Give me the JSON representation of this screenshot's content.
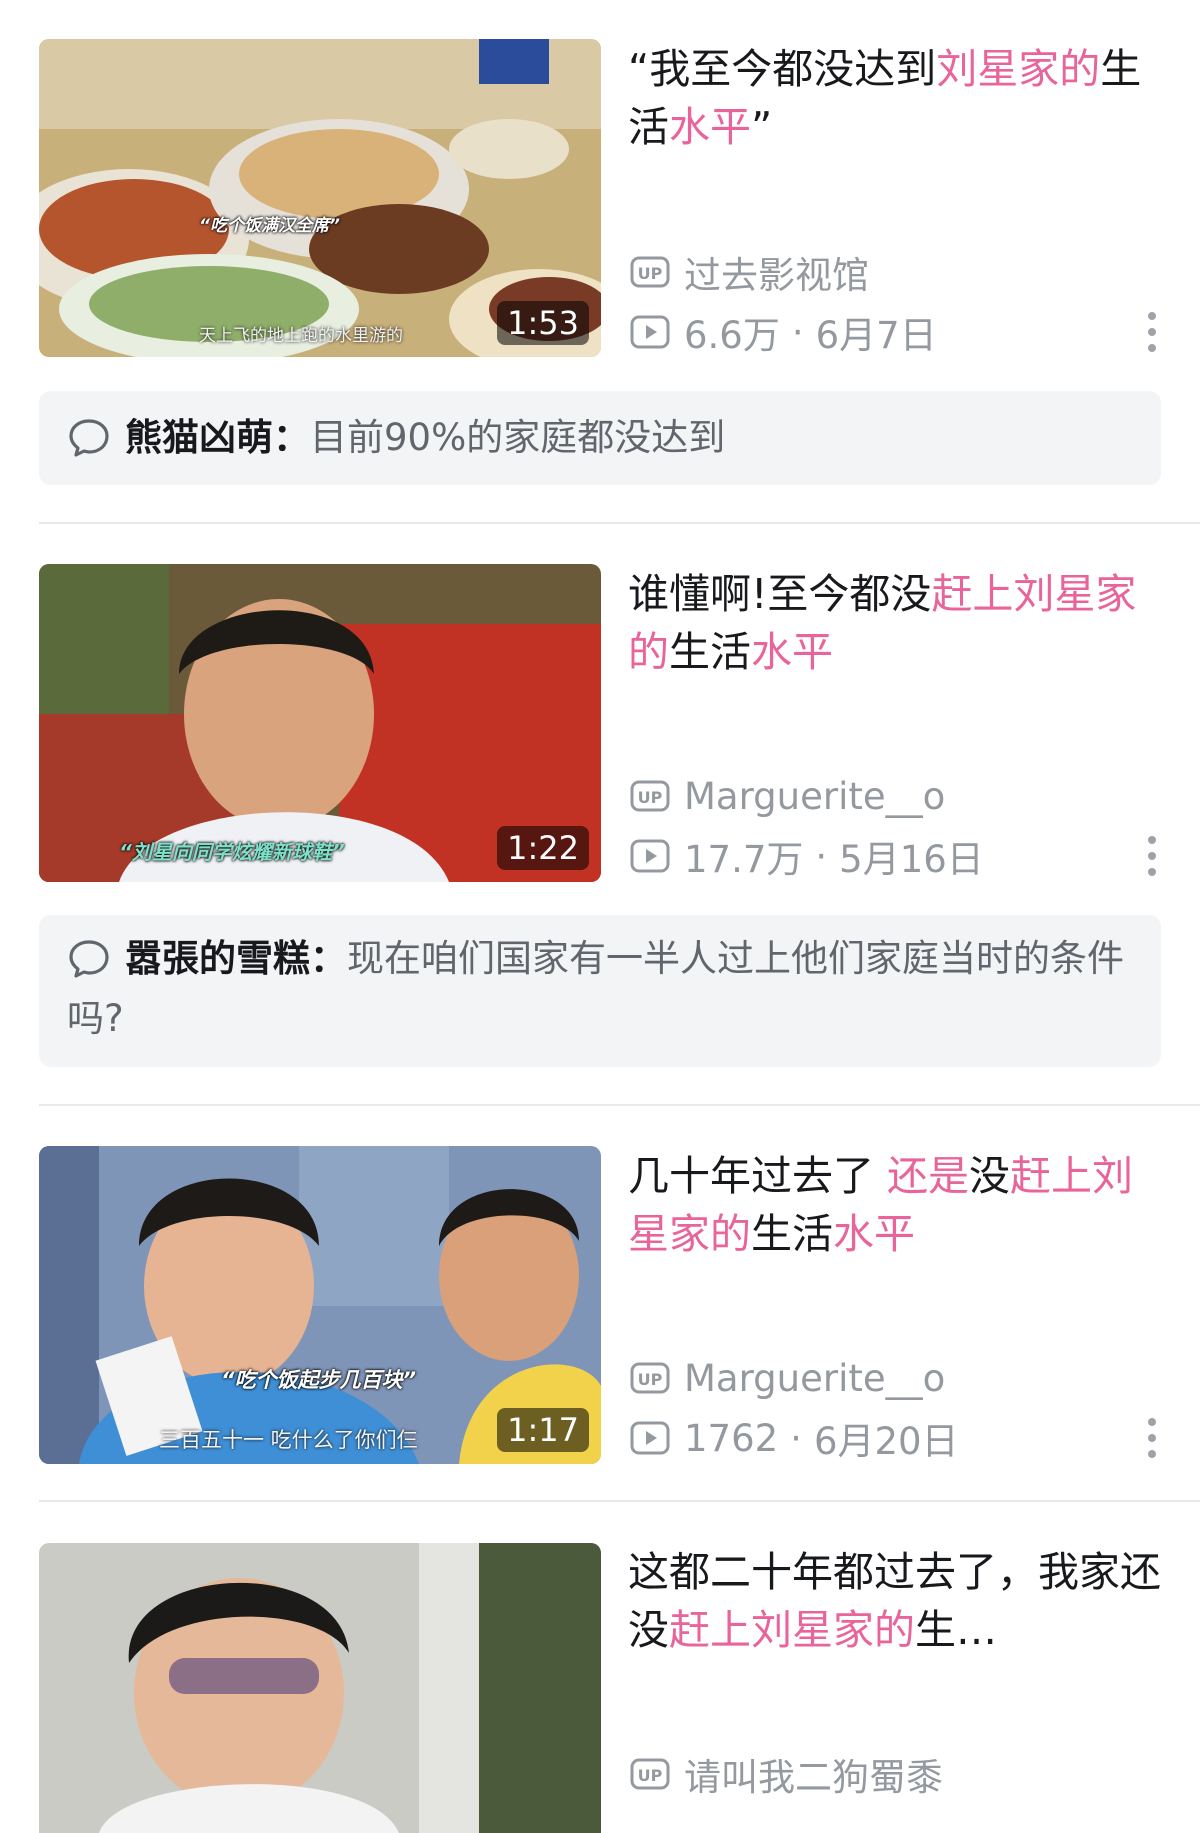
{
  "colors": {
    "highlight": "#e8649a",
    "meta": "#9499a0",
    "comment_bg": "#f3f4f6"
  },
  "videos": [
    {
      "title_parts": [
        {
          "text": "“我至今都没达到",
          "hl": false
        },
        {
          "text": "刘星家的",
          "hl": true
        },
        {
          "text": "生活",
          "hl": false
        },
        {
          "text": "水平",
          "hl": true
        },
        {
          "text": "”",
          "hl": false
        }
      ],
      "duration": "1:53",
      "thumb_subtitle": "“吃个饭满汉全席”",
      "thumb_caption": "天上飞的地上跑的水里游的",
      "uploader": "过去影视馆",
      "views": "6.6万",
      "date": "6月7日",
      "comment": {
        "name": "熊猫凶萌：",
        "text": "目前90%的家庭都没达到"
      }
    },
    {
      "title_parts": [
        {
          "text": "谁懂啊!至今都没",
          "hl": false
        },
        {
          "text": "赶上刘星家的",
          "hl": true
        },
        {
          "text": "生活",
          "hl": false
        },
        {
          "text": "水平",
          "hl": true
        }
      ],
      "duration": "1:22",
      "thumb_subtitle": "“刘星向同学炫耀新球鞋”",
      "thumb_caption": "",
      "uploader": "Marguerite__o",
      "views": "17.7万",
      "date": "5月16日",
      "comment": {
        "name": "嚣張的雪糕：",
        "text": "现在咱们国家有一半人过上他们家庭当时的条件吗?"
      }
    },
    {
      "title_parts": [
        {
          "text": "几十年过去了 ",
          "hl": false
        },
        {
          "text": "还是",
          "hl": true
        },
        {
          "text": "没",
          "hl": false
        },
        {
          "text": "赶上刘星家的",
          "hl": true
        },
        {
          "text": "生活",
          "hl": false
        },
        {
          "text": "水平",
          "hl": true
        }
      ],
      "duration": "1:17",
      "thumb_subtitle": "“吃个饭起步几百块”",
      "thumb_caption": "三百五十一  吃什么了你们仨",
      "uploader": "Marguerite__o",
      "views": "1762",
      "date": "6月20日",
      "comment": null
    },
    {
      "title_parts": [
        {
          "text": "这都二十年都过去了，我家还没",
          "hl": false
        },
        {
          "text": "赶上刘星家的",
          "hl": true
        },
        {
          "text": "生…",
          "hl": false
        }
      ],
      "duration": "",
      "thumb_subtitle": "",
      "thumb_caption": "",
      "uploader": "请叫我二狗蜀黍",
      "views": "",
      "date": "",
      "comment": null
    }
  ]
}
